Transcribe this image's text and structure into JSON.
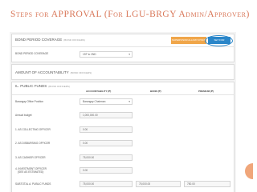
{
  "slide": {
    "title": "Steps for APPROVAL (For LGU-BRGY Admin/Approver)"
  },
  "bond": {
    "title": "BOND PERIOD COVERAGE",
    "title_note": "(BOND OFFICERS)",
    "btn_orange": "SUPERVISOR ALLOW SYNCS",
    "btn_blue": "SET FOR",
    "period_label": "BOND PERIOD COVERAGE",
    "period_value": "1ST to 2ND"
  },
  "amount": {
    "title": "AMOUNT OF ACCOUNTABILITY",
    "title_note": "(BOND OFFICERS)"
  },
  "funds": {
    "title": "IL. PUBLIC FUNDS",
    "title_note": "(BOND OFFICERS)",
    "col_accountability": "ACCOUNTABILITY (₱)",
    "col_bond": "BOND (₱)",
    "col_premium": "PREMIUM (₱)",
    "rows": [
      {
        "label": "Barangay Office Position",
        "value": "Barangay Chairman"
      },
      {
        "label": "Annual budget",
        "value": "1,000,000.00"
      },
      {
        "label": "1. AS COLLECTING OFFICER",
        "value": "0.00"
      },
      {
        "label": "2. AS DISBURSING OFFICER",
        "value": "0.00"
      },
      {
        "label": "3. AS CASHIER OFFICER",
        "value": "75,000.00"
      },
      {
        "label": "4. INVESTMENT OFFICER",
        "label2": "(SEE AS ESTIMATED)",
        "value": "0.00"
      },
      {
        "label": "SUBTOTAL A. PUBLIC FUNDS",
        "value": "75,000.00",
        "bond": "75,000.00",
        "premium": "750.00"
      }
    ]
  },
  "colors": {
    "title": "#d9785a",
    "orange_button": "#f0a64a",
    "blue_button": "#2a86c9",
    "deco": "#f0a67a"
  }
}
